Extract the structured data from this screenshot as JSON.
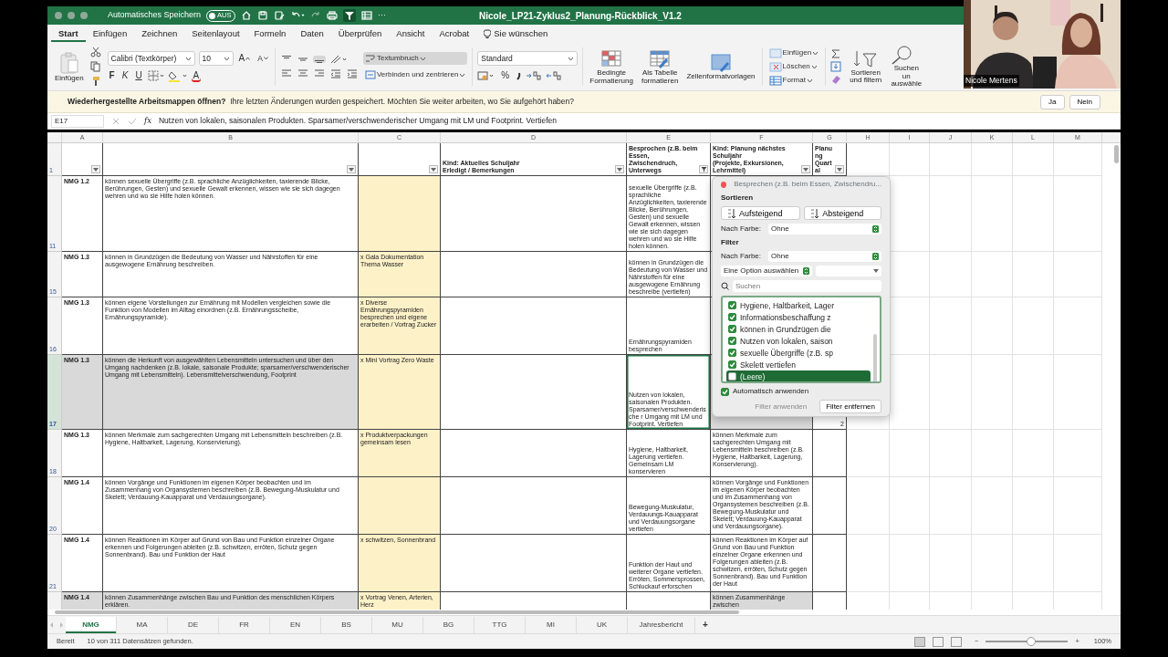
{
  "title_bar": {
    "autosave_label": "Automatisches Speichern",
    "autosave_toggle": {
      "label": "AUS",
      "on": false
    },
    "more": "···",
    "document_title": "Nicole_LP21-Zyklus2_Planung-Rückblick_V1.2"
  },
  "tabs": [
    {
      "label": "Start",
      "selected": true,
      "kind": "tab"
    },
    {
      "label": "Einfügen",
      "selected": false,
      "kind": "tab"
    },
    {
      "label": "Zeichnen",
      "selected": false,
      "kind": "tab"
    },
    {
      "label": "Seitenlayout",
      "selected": false,
      "kind": "tab"
    },
    {
      "label": "Formeln",
      "selected": false,
      "kind": "tab"
    },
    {
      "label": "Daten",
      "selected": false,
      "kind": "tab"
    },
    {
      "label": "Überprüfen",
      "selected": false,
      "kind": "tab"
    },
    {
      "label": "Ansicht",
      "selected": false,
      "kind": "tab"
    },
    {
      "label": "Acrobat",
      "selected": false,
      "kind": "tab"
    },
    {
      "label": "Sie wünschen",
      "selected": false,
      "kind": "tell"
    }
  ],
  "ribbon": {
    "paste_label": "Einfügen",
    "font_name": "Calibri (Textkörper)",
    "font_size": "10",
    "grow_font": "A",
    "shrink_font": "A",
    "bold": "F",
    "italic": "K",
    "underline": "U",
    "font_color": "A",
    "vertical_align": [
      {
        "selected": false
      },
      {
        "selected": false
      },
      {
        "selected": true
      }
    ],
    "wrap_text": {
      "label": "Textumbruch",
      "on": true
    },
    "merge": "Verbinden und zentrieren",
    "number_format": "Standard",
    "percent": "%",
    "styles": [
      "Bedingte\nFormatierung",
      "Als Tabelle\nformatieren",
      "Zellenformatvorlagen"
    ],
    "cells": [
      "Einfügen",
      "Löschen",
      "Format"
    ],
    "sort_filter": "Sortieren\nund filtern",
    "find_select": "Suchen un\nauswähle"
  },
  "message_bar": {
    "title": "Wiederhergestellte Arbeitsmappen öffnen?",
    "text": "Ihre letzten Änderungen wurden gespeichert. Möchten Sie weiter arbeiten, wo Sie aufgehört haben?",
    "buttons": [
      "Ja",
      "Nein"
    ]
  },
  "formula_bar": {
    "name_box": "E17",
    "fx": "fx",
    "content": "Nutzen von lokalen, saisonalen Produkten. Sparsamer/verschwenderischer Umgang mit LM und Footprint. Vertiefen"
  },
  "sheet": {
    "columns": [
      "A",
      "B",
      "C",
      "D",
      "E",
      "F",
      "G",
      "H",
      "I",
      "J",
      "K",
      "L",
      "M"
    ],
    "header_row": {
      "number": "1",
      "cells": [
        {
          "filtered": false
        },
        {
          "filtered": false
        },
        {
          "filtered": false
        },
        {
          "text": "Kind: Aktuelles Schuljahr\nErledigt / Bemerkungen",
          "filtered": false
        },
        {
          "text": "Besprochen (z.B. beim Essen,\nZwischendruch, Unterwegs",
          "filtered": true
        },
        {
          "text": "Kind: Planung nächstes Schuljahr\n(Projekte, Exkursionen, Lehrmittel)",
          "filtered": false
        },
        {
          "text": "Planung\nQuartal",
          "filtered": false
        }
      ]
    },
    "rows": [
      {
        "number": "11",
        "selected": false,
        "shaded": false,
        "cells": {
          "A": "NMG 1.2",
          "B": "können sexuelle Übergriffe (z.B. sprachliche Anzüglichkeiten, taxierende Blicke, Berührungen, Gesten) und sexuelle Gewalt erkennen, wissen wie sie sich dagegen wehren und wo sie Hilfe holen können.",
          "E": "sexuelle Übergriffe (z.B. sprachliche Anzüglichkeiten, taxierende Blicke, Berührungen, Gesten) und sexuelle Gewalt erkennen, wissen wie sie sich dagegen wehren und wo sie Hilfe holen können."
        }
      },
      {
        "number": "15",
        "selected": false,
        "shaded": false,
        "cells": {
          "A": "NMG 1.3",
          "B": "können in Grundzügen die Bedeutung von Wasser und Nährstoffen für eine ausgewogene Ernährung beschreiben.",
          "C": "x Gala Dokumentation Thema Wasser",
          "E": "können in Grundzügen die Bedeutung von Wasser und Nährstoffen für eine ausgewogene Ernährung beschreibe (vertiefen)"
        }
      },
      {
        "number": "16",
        "selected": false,
        "shaded": false,
        "cells": {
          "A": "NMG 1.3",
          "B": "können eigene Vorstellungen zur Ernährung mit Modellen vergleichen sowie die Funktion von Modellen im Alltag einordnen (z.B. Ernährungsscheibe, Ernährungspyramide).",
          "C": "x Diverse Ernährungspyramiden besprechen und eigene erarbeiten / Vortrag Zucker",
          "E": "Ernährungspyramiden besprechen"
        }
      },
      {
        "number": "17",
        "selected": true,
        "shaded": true,
        "cells": {
          "A": "NMG 1.3",
          "B": "können die Herkunft von ausgewählten Lebensmitteln untersuchen und über den Umgang nachdenken (z.B. lokale, saisonale Produkte; sparsamer/verschwenderischer Umgang mit Lebensmitteln). Lebensmittelverschwendung, Footprint",
          "C": "x Mini Vortrag Zero Waste",
          "E": "Nutzen von lokalen, saisonalen Produkten. Sparsamer/verschwenderische r Umgang mit LM und Footprint. Vertiefen",
          "G": "2"
        }
      },
      {
        "number": "18",
        "selected": false,
        "shaded": false,
        "cells": {
          "A": "NMG 1.3",
          "B": "können Merkmale zum sachgerechten Umgang mit Lebensmitteln beschreiben (z.B. Hygiene, Haltbarkeit, Lagerung, Konservierung).",
          "C": "x Produktverpackungen gemeinsam lesen",
          "E": "Hygiene, Haltbarkeit, Lagerung vertiefen. Gemeinsam LM konservieren",
          "F": "können Merkmale zum sachgerechten Umgang mit Lebensmitteln beschreiben (z.B. Hygiene, Haltbarkeit, Lagerung, Konservierung)."
        }
      },
      {
        "number": "20",
        "selected": false,
        "shaded": false,
        "cells": {
          "A": "NMG 1.4",
          "B": "können Vorgänge und Funktionen im eigenen Körper beobachten und im Zusammenhang von Organsystemen beschreiben (z.B. Bewegung-Muskulatur und Skelett; Verdauung-Kauapparat und Verdauungsorgane).",
          "E": "Bewegung-Muskulatur, Verdauungs-Kauapparat und Verdauungsorgane vertiefen",
          "F": "können Vorgänge und Funktionen im eigenen Körper beobachten und im Zusammenhang von Organsystemen beschreiben (z.B. Bewegung-Muskulatur und Skelett; Verdauung-Kauapparat und Verdauungsorgane)."
        }
      },
      {
        "number": "21",
        "selected": false,
        "shaded": false,
        "cells": {
          "A": "NMG 1.4",
          "B": "können Reaktionen im Körper auf Grund von Bau und Funktion einzelner Organe erkennen und Folgerungen ableiten (z.B. schwitzen, erröten, Schutz gegen Sonnenbrand).    Bau und Funktion der Haut",
          "C": "x schwitzen, Sonnenbrand",
          "E": "Funktion der Haut und weiterer Organe vertiefen.  Erröten, Sommersprossen, Schluckauf erforschen",
          "F": "können Reaktionen im Körper auf Grund von Bau und Funktion einzelner Organe erkennen und Folgerungen ableiten (z.B. schwitzen, erröten, Schutz gegen Sonnenbrand).    Bau und Funktion der Haut"
        }
      },
      {
        "selected": false,
        "shaded": true,
        "cells": {
          "A": "NMG 1.4",
          "B": "können Zusammenhänge zwischen Bau und Funktion des menschlichen Körpers erklären.",
          "C": "x Vortrag Venen, Arterien, Herz",
          "F": "können Zusammenhänge zwischen"
        }
      }
    ]
  },
  "filter_panel": {
    "title": "Besprechen (z.B. beim Essen, Zwischendru...",
    "sort_heading": "Sortieren",
    "sort_buttons": [
      "Aufsteigend",
      "Absteigend"
    ],
    "sort_color_label": "Nach Farbe:",
    "sort_color_value": "Ohne",
    "filter_heading": "Filter",
    "filter_color_label": "Nach Farbe:",
    "filter_color_value": "Ohne",
    "option_select": "Eine Option auswählen",
    "search_placeholder": "Suchen",
    "items": [
      {
        "label": "Hygiene, Haltbarkeit, Lager",
        "checked": true,
        "selected": false
      },
      {
        "label": "Informationsbeschaffung z",
        "checked": true,
        "selected": false
      },
      {
        "label": "können in Grundzügen die",
        "checked": true,
        "selected": false
      },
      {
        "label": "Nutzen von lokalen, saison",
        "checked": true,
        "selected": false
      },
      {
        "label": "sexuelle Übergriffe (z.B. sp",
        "checked": true,
        "selected": false
      },
      {
        "label": "Skelett vertiefen",
        "checked": true,
        "selected": false
      },
      {
        "label": "(Leere)",
        "checked": false,
        "selected": true
      }
    ],
    "auto_apply": {
      "label": "Automatisch anwenden",
      "checked": true
    },
    "buttons": [
      {
        "label": "Filter anwenden",
        "disabled": true
      },
      {
        "label": "Filter entfernen",
        "disabled": false
      }
    ]
  },
  "sheet_tabs": [
    {
      "label": "NMG",
      "selected": true
    },
    {
      "label": "MA",
      "selected": false
    },
    {
      "label": "DE",
      "selected": false
    },
    {
      "label": "FR",
      "selected": false
    },
    {
      "label": "EN",
      "selected": false
    },
    {
      "label": "BS",
      "selected": false
    },
    {
      "label": "MU",
      "selected": false
    },
    {
      "label": "BG",
      "selected": false
    },
    {
      "label": "TTG",
      "selected": false
    },
    {
      "label": "MI",
      "selected": false
    },
    {
      "label": "UK",
      "selected": false
    },
    {
      "label": "Jahresbericht",
      "selected": false
    }
  ],
  "add_sheet": "+",
  "status_bar": {
    "mode": "Bereit",
    "message": "10 von 311 Datensätzen gefunden.",
    "views": [
      {
        "selected": true
      },
      {
        "selected": false
      },
      {
        "selected": false
      }
    ],
    "zoom_minus": "−",
    "zoom": {
      "level": 0.55
    },
    "zoom_plus": "+",
    "zoom_label": "100%"
  },
  "video": {
    "participant": "Nicole Mertens"
  }
}
